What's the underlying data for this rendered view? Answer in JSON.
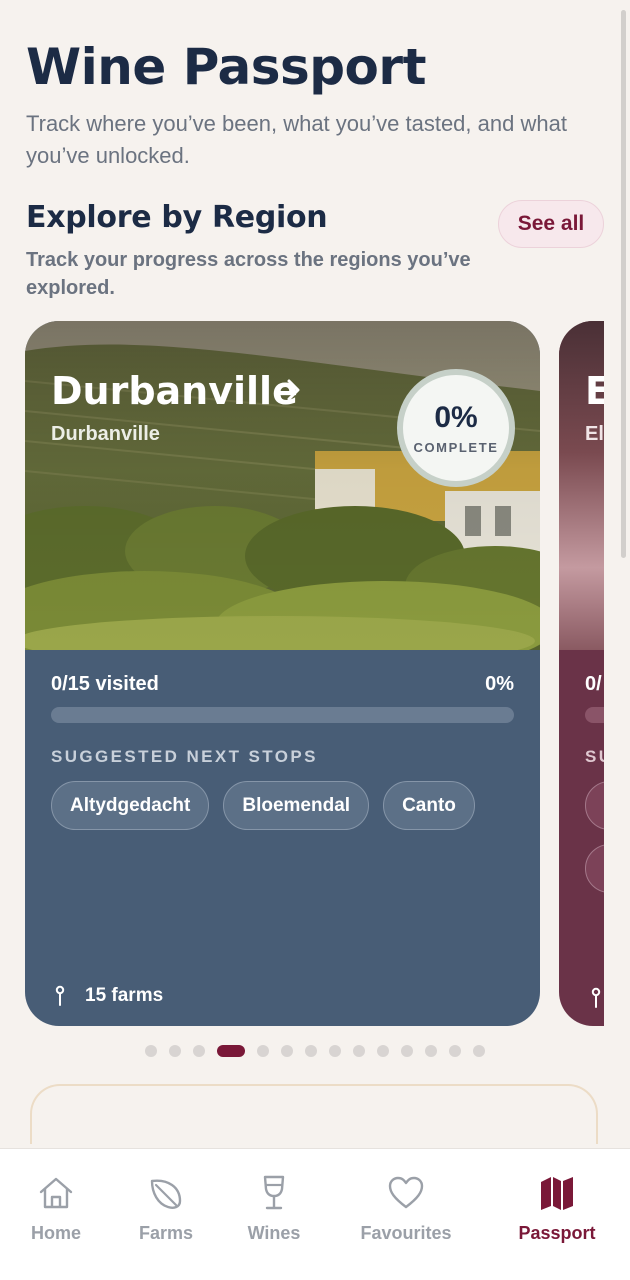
{
  "header": {
    "title": "Wine Passport",
    "subtitle": "Track where you’ve been, what you’ve tasted, and what you’ve unlocked."
  },
  "section": {
    "title": "Explore by Region",
    "see_all": "See all",
    "subtitle": "Track your progress across the regions you’ve explored."
  },
  "region_card": {
    "name": "Durbanville",
    "sub": "Durbanville",
    "badge_percent": "0%",
    "badge_label": "COMPLETE",
    "visited": "0/15 visited",
    "visited_percent": "0%",
    "progress": 0,
    "suggest_heading": "SUGGESTED NEXT STOPS",
    "suggested": [
      "Altydgedacht",
      "Bloemendal",
      "Canto"
    ],
    "farms": "15 farms"
  },
  "peek_card": {
    "title": "E",
    "sub": "El",
    "visited": "0/",
    "heading": "SU"
  },
  "pager": {
    "count": 14,
    "active": 3
  },
  "tabbar": {
    "items": [
      {
        "label": "Home",
        "icon": "home-icon"
      },
      {
        "label": "Farms",
        "icon": "leaf-icon"
      },
      {
        "label": "Wines",
        "icon": "wine-glass-icon"
      },
      {
        "label": "Favourites",
        "icon": "heart-icon"
      },
      {
        "label": "Passport",
        "icon": "map-icon"
      }
    ],
    "active": 4
  },
  "colors": {
    "primary": "#7a1838",
    "navy": "#1c2b45",
    "card_blue": "#485d76",
    "card_wine": "#6a3348",
    "background": "#f6f2ee"
  }
}
